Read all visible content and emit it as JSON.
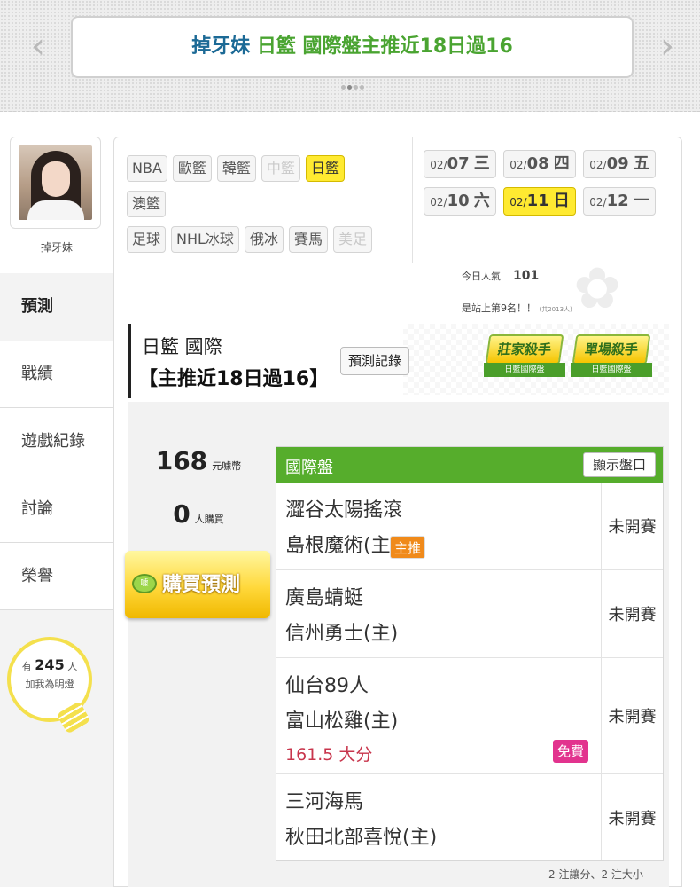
{
  "banner": {
    "name": "掉牙妹",
    "title": "日籃 國際盤主推近18日過16",
    "prev_arrow": "‹",
    "next_arrow": "›"
  },
  "profile": {
    "name": "掉牙妹"
  },
  "nav": {
    "items": [
      {
        "label": "預測",
        "active": true
      },
      {
        "label": "戰績"
      },
      {
        "label": "遊戲紀錄"
      },
      {
        "label": "討論"
      },
      {
        "label": "榮譽"
      }
    ]
  },
  "fans": {
    "prefix": "有",
    "count": "245",
    "unit": "人",
    "text": "加我為明燈"
  },
  "leagues": {
    "row1": [
      "NBA",
      "歐籃",
      "韓籃",
      "中籃",
      "日籃"
    ],
    "row2": [
      "澳籃"
    ],
    "row3": [
      "足球",
      "NHL冰球",
      "俄冰",
      "賽馬",
      "美足"
    ]
  },
  "dates": [
    {
      "md": "02/",
      "d": "07",
      "wd": "三"
    },
    {
      "md": "02/",
      "d": "08",
      "wd": "四"
    },
    {
      "md": "02/",
      "d": "09",
      "wd": "五"
    },
    {
      "md": "02/",
      "d": "10",
      "wd": "六"
    },
    {
      "md": "02/",
      "d": "11",
      "wd": "日"
    },
    {
      "md": "02/",
      "d": "12",
      "wd": "一"
    }
  ],
  "popularity": {
    "label": "今日人氣",
    "value": "101",
    "rank": "是站上第9名！！",
    "total": "(共2013人)"
  },
  "header": {
    "title": "日籃 國際",
    "subtitle": "【主推近18日過16】",
    "record_button": "預測記錄",
    "badge1_top": "莊家殺手",
    "badge1_bottom": "日籃國際盤",
    "badge2_top": "單場殺手",
    "badge2_bottom": "日籃國際盤"
  },
  "stats": {
    "price": "168",
    "price_unit": "元噱幣",
    "buyers": "0",
    "buyers_unit": "人購買",
    "buy_button": "購買預測",
    "coin_label": "噱"
  },
  "games_table": {
    "title": "國際盤",
    "show_odds": "顯示盤口",
    "rows": [
      {
        "away": "澀谷太陽搖滾",
        "home": "島根魔術(主)",
        "status": "未開賽",
        "tag": "主推",
        "pick": ""
      },
      {
        "away": "廣島蜻蜓",
        "home": "信州勇士(主)",
        "status": "未開賽",
        "tag": "",
        "pick": ""
      },
      {
        "away": "仙台89人",
        "home": "富山松雞(主)",
        "status": "未開賽",
        "tag": "免費",
        "pick": "161.5 大分"
      },
      {
        "away": "三河海馬",
        "home": "秋田北部喜悅(主)",
        "status": "未開賽",
        "tag": "",
        "pick": ""
      }
    ]
  },
  "footnote": "2 注讓分、2 注大小"
}
